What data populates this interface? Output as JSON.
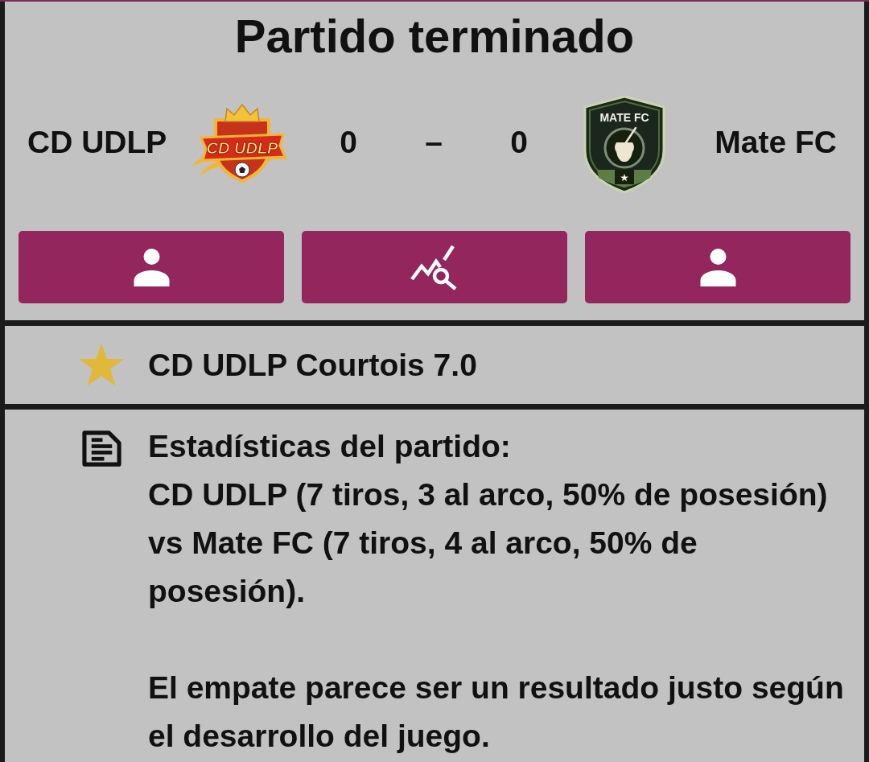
{
  "title": "Partido terminado",
  "match": {
    "home": {
      "name": "CD UDLP",
      "crest_text": "CD UDLP"
    },
    "score": {
      "home": "0",
      "separator": "–",
      "away": "0"
    },
    "away": {
      "name": "Mate FC",
      "crest_text": "MATE FC"
    }
  },
  "buttons": [
    {
      "kind": "person"
    },
    {
      "kind": "analysis"
    },
    {
      "kind": "person"
    }
  ],
  "highlight": {
    "text": "CD UDLP Courtois 7.0"
  },
  "summary": {
    "text": "Estadísticas del partido:\nCD UDLP (7 tiros, 3 al arco, 50% de posesión) vs Mate FC (7 tiros, 4 al arco, 50% de posesión).\n\nEl empate parece ser un resultado justo según el desarrollo del juego."
  }
}
